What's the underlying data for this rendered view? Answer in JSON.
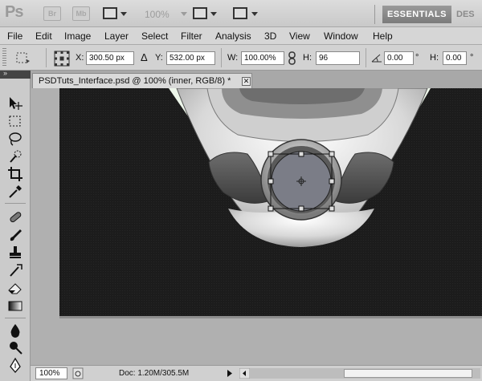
{
  "app": {
    "logo": "Ps",
    "launch_bridge": "Br",
    "launch_minibridge": "Mb",
    "zoom_level": "100%",
    "workspace": "ESSENTIALS",
    "workspace_next": "DES"
  },
  "menu": [
    "File",
    "Edit",
    "Image",
    "Layer",
    "Select",
    "Filter",
    "Analysis",
    "3D",
    "View",
    "Window",
    "Help"
  ],
  "options": {
    "x_label": "X:",
    "x_value": "300.50 px",
    "y_label": "Y:",
    "y_value": "532.00 px",
    "w_label": "W:",
    "w_value": "100.00%",
    "h_label": "H:",
    "h_value": "96",
    "angle_value": "0.00",
    "angle_unit": "°",
    "h2_label": "H:",
    "h2_value": "0.00",
    "h2_unit": "°"
  },
  "document": {
    "tab_title": "PSDTuts_Interface.psd @ 100% (inner, RGB/8) *",
    "close_glyph": "✕"
  },
  "status": {
    "zoom": "100%",
    "doc_info": "Doc: 1.20M/305.5M"
  },
  "colors": {
    "canvas_bg": "#1a1a1a",
    "accent_mint": "#edf6ea",
    "metal_light": "#c9c9c9",
    "inner_circle": "#7b7d87"
  }
}
